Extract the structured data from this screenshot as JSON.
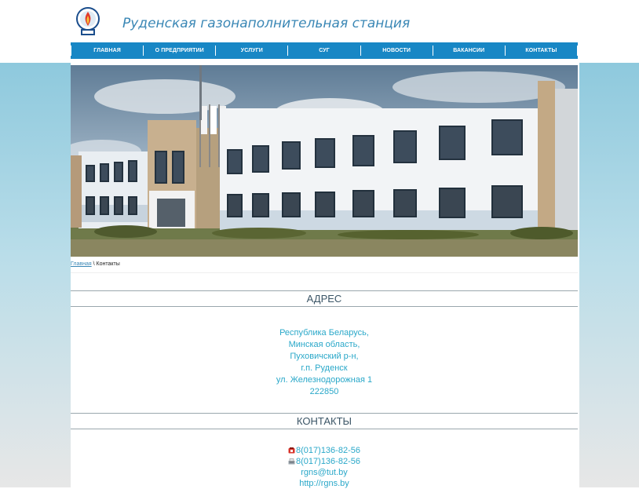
{
  "header": {
    "site_title": "Руденская газонаполнительная станция"
  },
  "nav": {
    "items": [
      "ГЛАВНАЯ",
      "О ПРЕДПРИЯТИИ",
      "УСЛУГИ",
      "СУГ",
      "НОВОСТИ",
      "ВАКАНСИИ",
      "КОНТАКТЫ"
    ]
  },
  "breadcrumb": {
    "home": "Главная",
    "separator": " \\ ",
    "current": "Контакты"
  },
  "address": {
    "title": "АДРЕС",
    "lines": [
      "Республика Беларусь,",
      "Минская область,",
      "Пуховичский р-н,",
      "г.п. Руденск",
      "ул. Железнодорожная 1",
      "222850"
    ]
  },
  "contacts": {
    "title": "КОНТАКТЫ",
    "phone": "8(017)136-82-56",
    "fax": "8(017)136-82-56",
    "email": "rgns@tut.by",
    "site": "http://rgns.by"
  },
  "colors": {
    "nav": "#1887c5",
    "accent": "#2aa8c9",
    "title": "#3a87b5"
  },
  "icons": {
    "phone": "phone-icon",
    "fax": "fax-icon",
    "logo": "company-logo"
  }
}
